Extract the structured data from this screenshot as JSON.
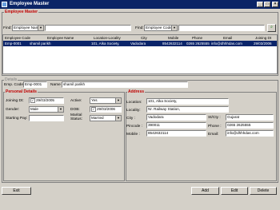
{
  "window": {
    "title": "Employee Master"
  },
  "master_section": {
    "label": "Employee Master"
  },
  "filters": [
    {
      "label": "Find:",
      "field": "Employee Nam",
      "value": ""
    },
    {
      "label": "Find:",
      "field": "Employee Code",
      "value": ""
    }
  ],
  "grid": {
    "columns": [
      "Employee Code",
      "Employee Name",
      "Location-Locality",
      "City",
      "Mobile",
      "Phone",
      "Email",
      "Joining Dt"
    ],
    "rows": [
      [
        "Emp-0001",
        "shamil parikh",
        "101, Alka Society,",
        "Vadodara",
        "8542632114",
        "0265 2625555",
        "info@dhhhdas.com",
        "29/03/2006"
      ]
    ]
  },
  "details": {
    "label": "Details",
    "emp_code_label": "Emp. Code",
    "emp_code": "Emp-0001",
    "name_label": "Name",
    "name": "shamil parikh"
  },
  "personal": {
    "label": "Personal Details",
    "joining_label": "Joining Dt:",
    "joining": "29/03/2005",
    "active_label": "Active:",
    "active": "Yes",
    "gender_label": "Gender:",
    "gender": "Male",
    "dob_label": "DOB:",
    "dob": "29/03/2006",
    "salary_label": "Starting Pay:",
    "salary": "",
    "marital_label": "Marital Status:",
    "marital": "Married"
  },
  "address": {
    "label": "Address",
    "location_label": "Location:",
    "location": "101, Alka Society,",
    "locality_label": "Locality:",
    "locality": "Nr. Railway Station,",
    "city_label": "City :",
    "city": "Vadodara",
    "state_label": "St/Cty :",
    "state": "Gujarat",
    "pincode_label": "Pincode :",
    "pincode": "390011",
    "phone_label": "Phone :",
    "phone": "0265 2625555",
    "mobile_label": "Mobile :",
    "mobile": "8542632114",
    "email_label": "Email:",
    "email": "info@dhhhdas.com"
  },
  "buttons": {
    "exit": "Exit",
    "add": "Add",
    "edit": "Edit",
    "delete": "Delete"
  },
  "colors": {
    "title_bar": "#0a2466",
    "selection": "#0a246a",
    "section_label": "#c00000"
  }
}
